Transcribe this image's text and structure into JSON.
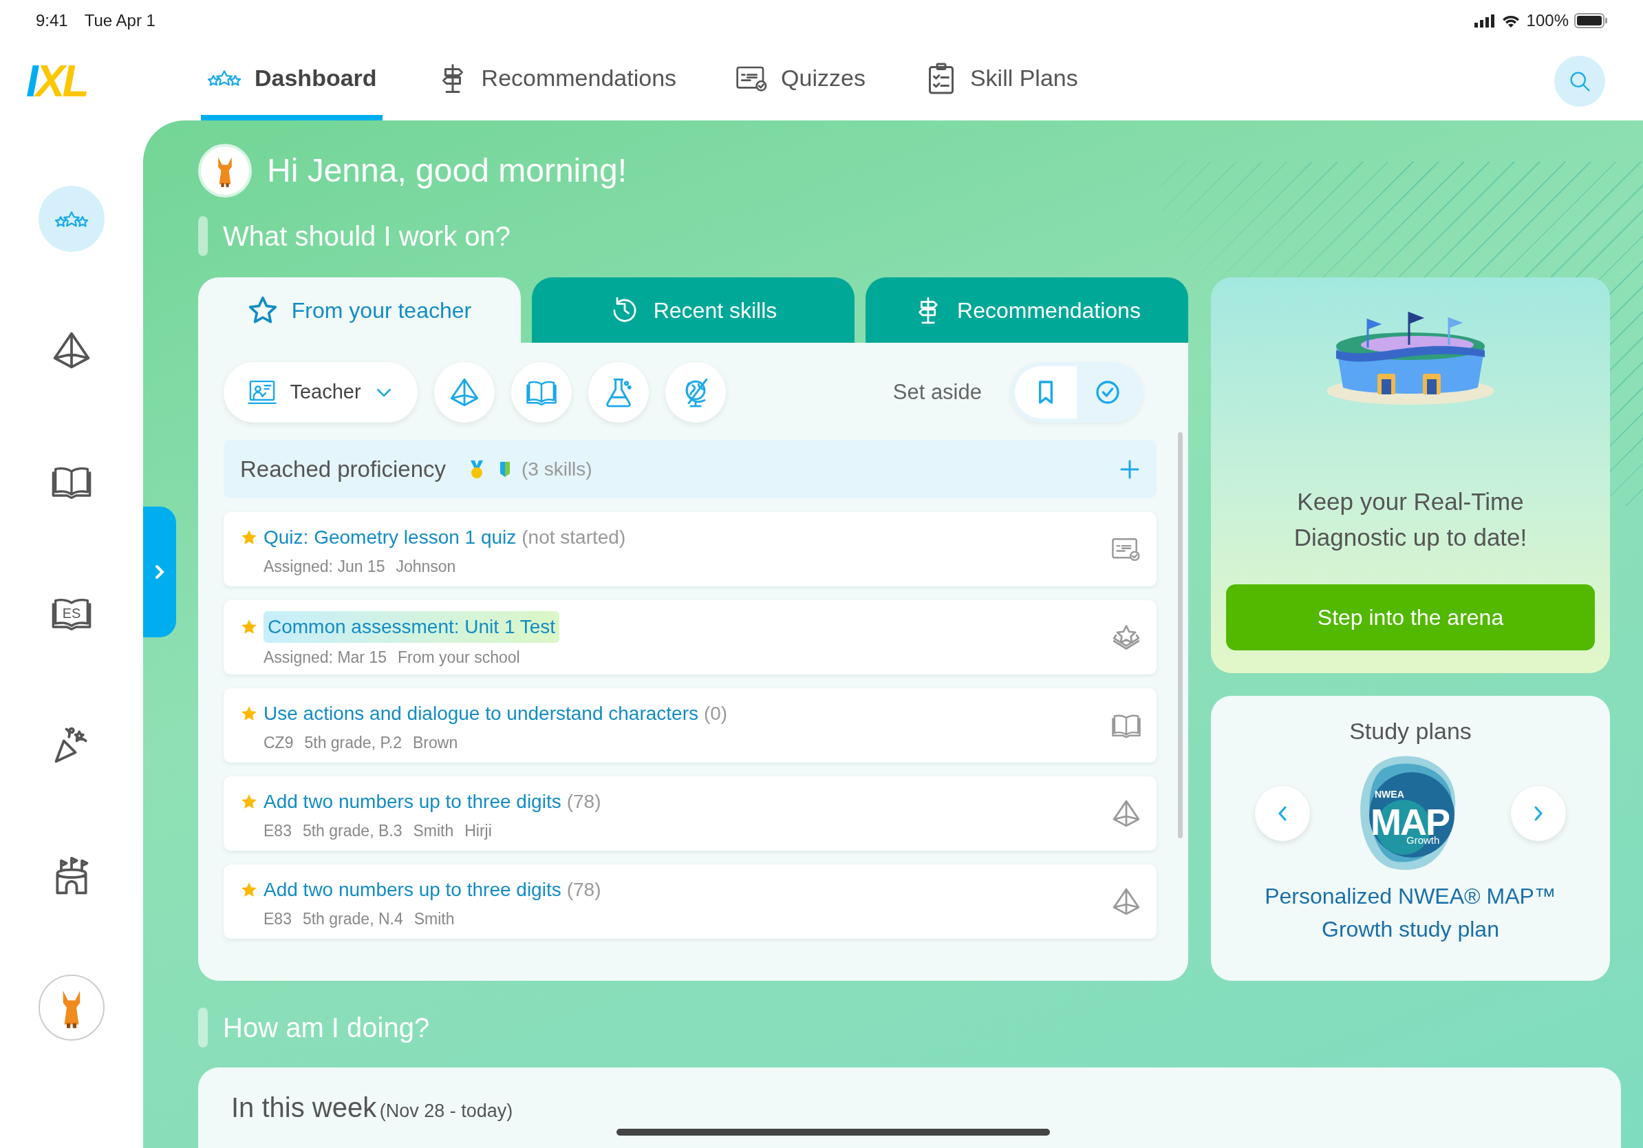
{
  "status_bar": {
    "time": "9:41",
    "date": "Tue Apr 1",
    "battery": "100%"
  },
  "nav": {
    "logo": "IXL",
    "tabs": [
      {
        "label": "Dashboard",
        "selected": true
      },
      {
        "label": "Recommendations",
        "selected": false
      },
      {
        "label": "Quizzes",
        "selected": false
      },
      {
        "label": "Skill Plans",
        "selected": false
      }
    ]
  },
  "sidebar": {
    "items": [
      {
        "selected": true
      },
      {
        "selected": false
      },
      {
        "selected": false
      },
      {
        "selected": false,
        "label": "ES"
      },
      {
        "selected": false
      },
      {
        "selected": false
      }
    ]
  },
  "greeting": "Hi Jenna, good morning!",
  "section_title": "What should I work on?",
  "work_tabs": [
    {
      "label": "From your teacher",
      "selected": true
    },
    {
      "label": "Recent skills",
      "selected": false
    },
    {
      "label": "Recommendations",
      "selected": false
    }
  ],
  "filters": {
    "teacher": "Teacher",
    "set_aside": {
      "label": "Set aside",
      "options": [
        {
          "selected": true
        },
        {
          "selected": false
        }
      ]
    }
  },
  "group": {
    "title": "Reached proficiency",
    "count": "(3 skills)",
    "expanded": false
  },
  "rows": [
    {
      "kind": "quiz",
      "title": "Quiz: Geometry lesson 1 quiz",
      "note": "(not started)",
      "highlighted": false,
      "meta": [
        "Assigned: Jun 15",
        "Johnson"
      ]
    },
    {
      "kind": "assessment",
      "title": "Common assessment: Unit 1 Test",
      "highlighted": true,
      "meta": [
        "Assigned: Mar 15",
        "From your school"
      ]
    },
    {
      "kind": "reading",
      "title": "Use actions and dialogue to understand characters",
      "note": "(0)",
      "highlighted": false,
      "meta": [
        "CZ9",
        "5th grade, P.2",
        "Brown"
      ]
    },
    {
      "kind": "math",
      "title": "Add two numbers up to three digits",
      "note": "(78)",
      "highlighted": false,
      "meta": [
        "E83",
        "5th grade, B.3",
        "Smith",
        "Hirji"
      ]
    },
    {
      "kind": "math",
      "title": "Add two numbers up to three digits",
      "note": "(78)",
      "highlighted": false,
      "meta": [
        "E83",
        "5th grade, N.4",
        "Smith"
      ]
    }
  ],
  "arena": {
    "message": "Keep your Real-Time Diagnostic up to date!",
    "button": "Step into the arena"
  },
  "study_plans": {
    "title": "Study plans",
    "logo": {
      "top": "NWEA",
      "main": "MAP",
      "bottom": "Growth"
    },
    "link": "Personalized NWEA® MAP™ Growth study plan"
  },
  "progress_title": "How am I doing?",
  "week": {
    "title": "In this week",
    "range": "(Nov 28 - today)"
  }
}
